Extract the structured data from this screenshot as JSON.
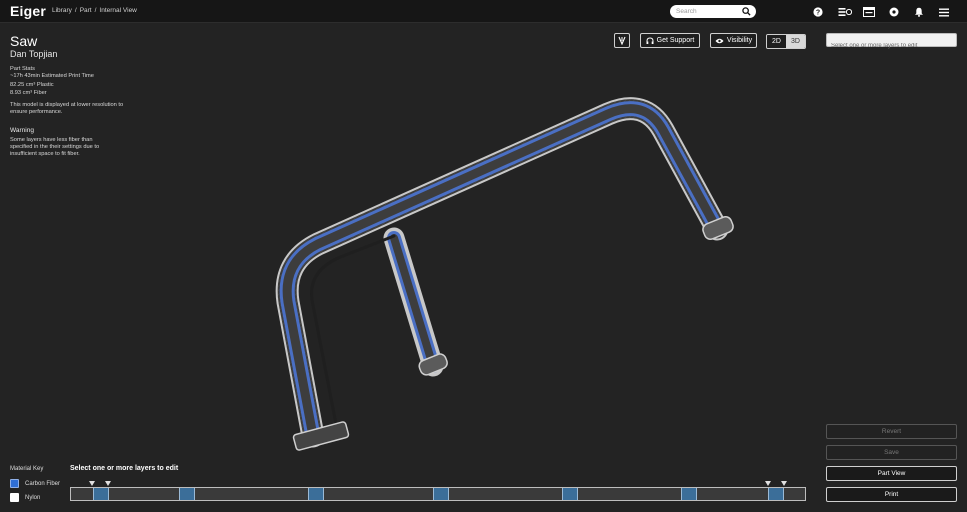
{
  "app": {
    "name": "Eiger"
  },
  "breadcrumb": [
    "Library",
    "/",
    "Part",
    "/",
    "Internal View"
  ],
  "search": {
    "placeholder": "Search"
  },
  "nav_icons": [
    "help-icon",
    "print-queue-icon",
    "printer-icon",
    "settings-icon",
    "bell-icon",
    "menu-icon"
  ],
  "part": {
    "name": "Saw",
    "owner": "Dan Topjian",
    "stats_heading": "Part Stats",
    "print_time": "~17h 43min Estimated Print Time",
    "plastic": "82.25 cm³ Plastic",
    "fiber": "8.93 cm³ Fiber",
    "resolution_note": "This model is displayed at lower resolution to ensure performance."
  },
  "warning": {
    "heading": "Warning",
    "text": "Some layers have less fiber than specified in the their settings due to insufficient space to fit fiber."
  },
  "toolbar": {
    "support_label": "Get Support",
    "visibility_label": "Visibility",
    "view_2d": "2D",
    "view_3d": "3D",
    "active_view": "2D"
  },
  "layer_select": {
    "placeholder": "Select one or more layers to edit"
  },
  "actions": {
    "revert": "Revert",
    "save": "Save",
    "part_view": "Part View",
    "print": "Print"
  },
  "material_key": {
    "title": "Material Key",
    "items": [
      {
        "label": "Carbon Fiber",
        "color": "#2f6fd6"
      },
      {
        "label": "Nylon",
        "color": "#ffffff"
      }
    ]
  },
  "layers_bar": {
    "label": "Select one or more layers to edit"
  },
  "colors": {
    "background": "#232323",
    "topbar": "#161616",
    "fiber": "#4a6fc4",
    "accent_bump": "#3b6e99"
  }
}
